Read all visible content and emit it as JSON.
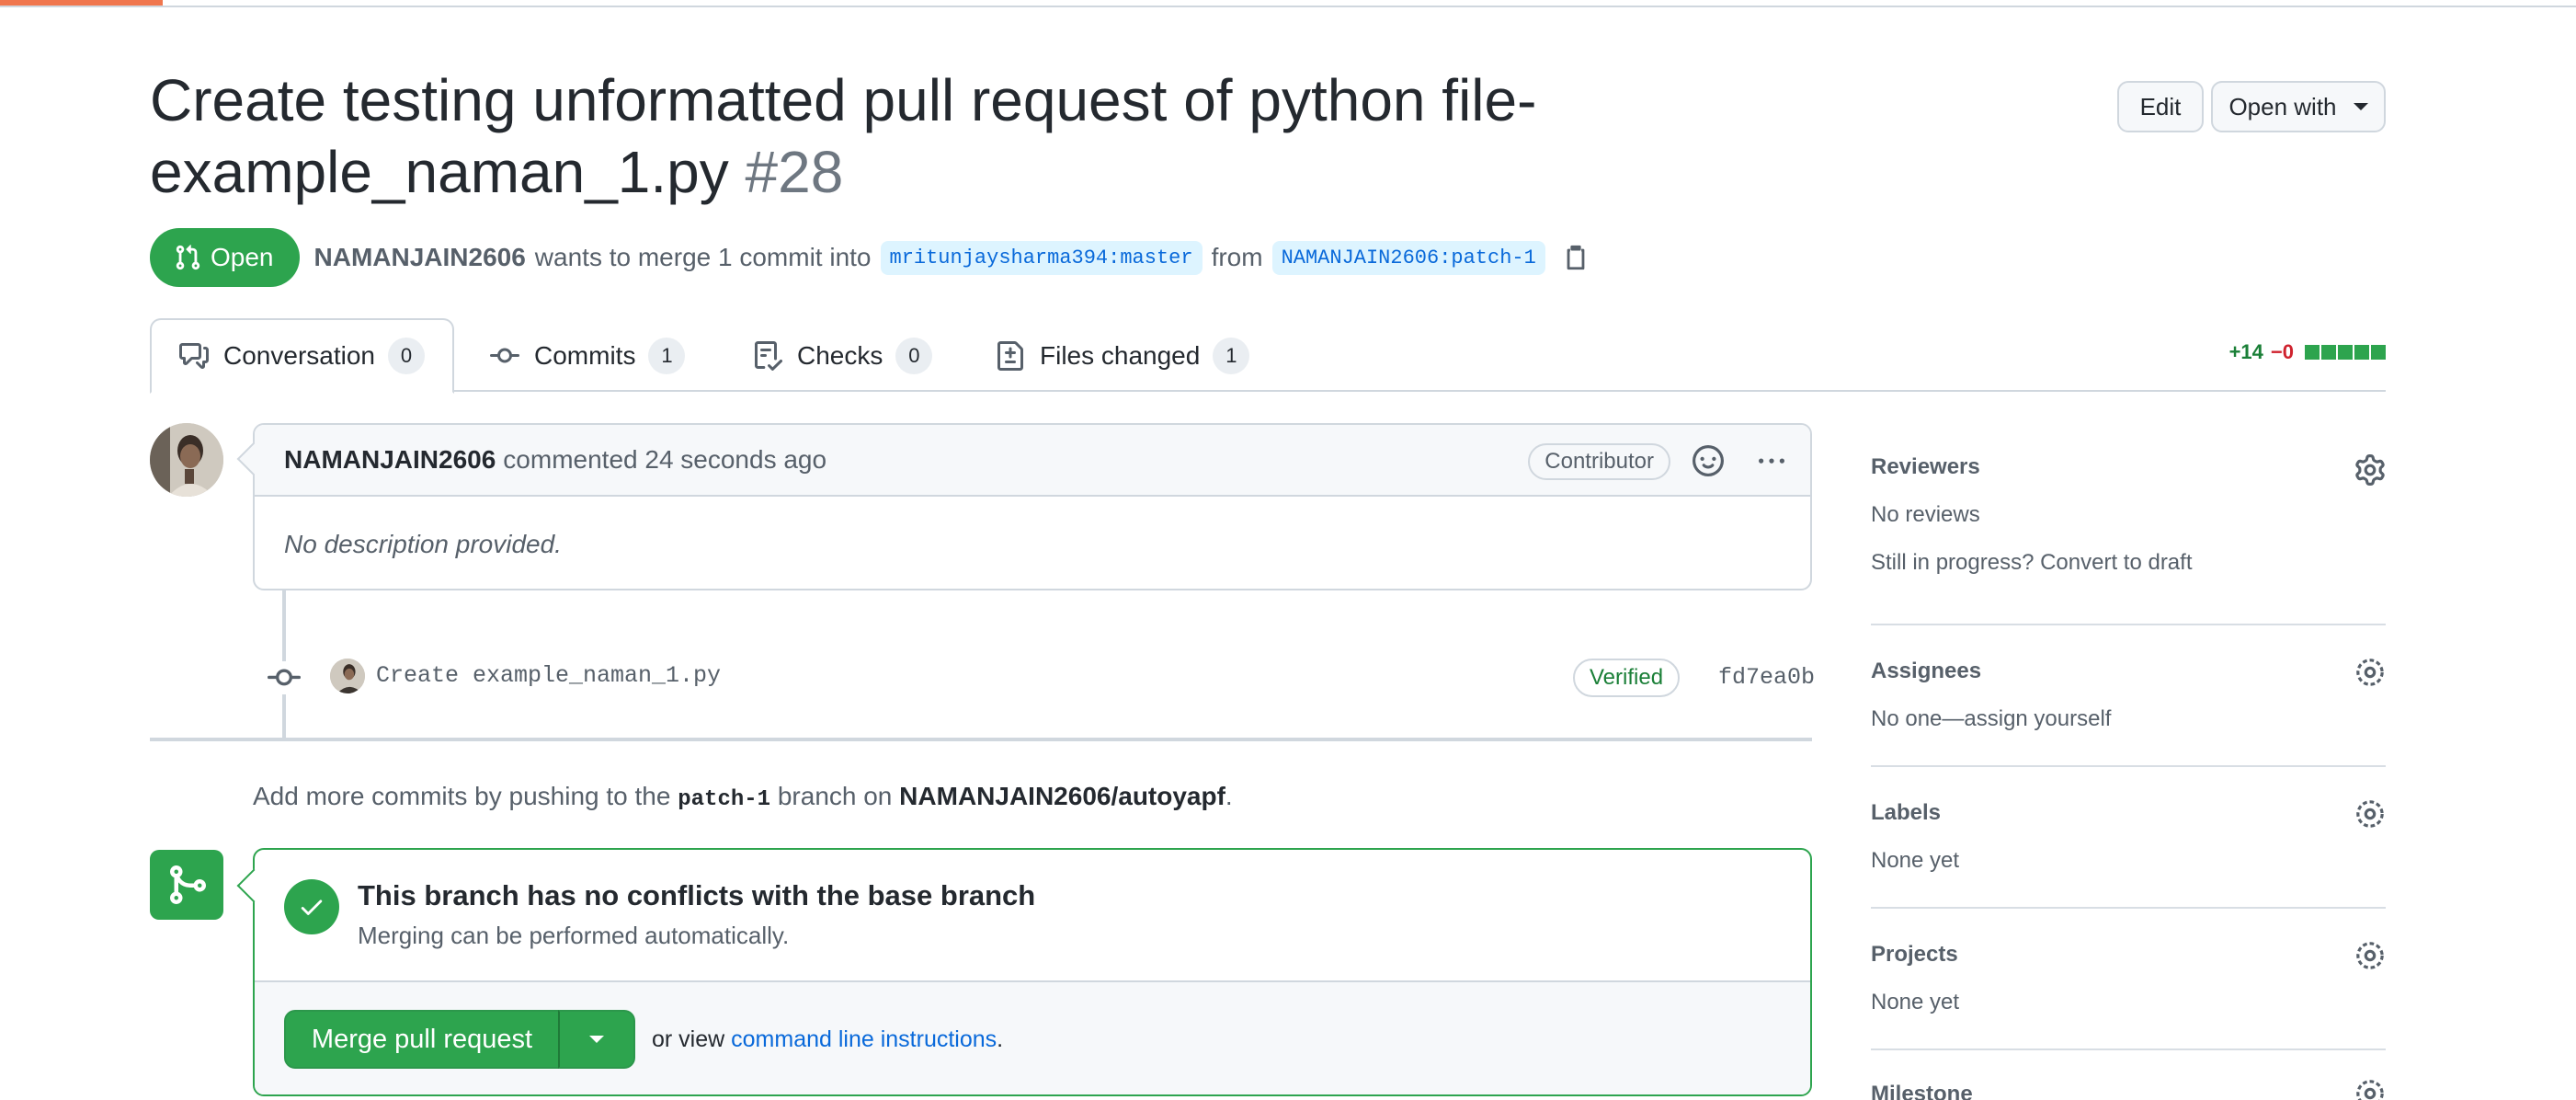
{
  "page_load_progress": 0.063,
  "header": {
    "title": "Create testing unformatted pull request of python file-example_naman_1.py",
    "number": "#28",
    "edit_label": "Edit",
    "open_with_label": "Open with"
  },
  "meta": {
    "state": "Open",
    "author": "NAMANJAIN2606",
    "merge_text": "wants to merge 1 commit into",
    "base_branch": "mritunjaysharma394:master",
    "from_text": "from",
    "head_branch": "NAMANJAIN2606:patch-1"
  },
  "tabs": [
    {
      "label": "Conversation",
      "count": "0"
    },
    {
      "label": "Commits",
      "count": "1"
    },
    {
      "label": "Checks",
      "count": "0"
    },
    {
      "label": "Files changed",
      "count": "1"
    }
  ],
  "diffstat": {
    "additions": "+14",
    "deletions": "−0"
  },
  "comment": {
    "author": "NAMANJAIN2606",
    "action": "commented 24 seconds ago",
    "badge": "Contributor",
    "body": "No description provided."
  },
  "commit": {
    "message": "Create example_naman_1.py",
    "verified": "Verified",
    "sha": "fd7ea0b"
  },
  "add_more": {
    "prefix": "Add more commits by pushing to the",
    "branch": "patch-1",
    "middle": "branch on",
    "repo": "NAMANJAIN2606/autoyapf",
    "suffix": "."
  },
  "mergebox": {
    "title": "This branch has no conflicts with the base branch",
    "subtitle": "Merging can be performed automatically.",
    "button": "Merge pull request",
    "or_view": "or view",
    "link": "command line instructions",
    "period": "."
  },
  "sidebar": {
    "reviewers": {
      "title": "Reviewers",
      "text": "No reviews",
      "draft": "Still in progress? Convert to draft"
    },
    "assignees": {
      "title": "Assignees",
      "text": "No one—assign yourself"
    },
    "labels": {
      "title": "Labels",
      "text": "None yet"
    },
    "projects": {
      "title": "Projects",
      "text": "None yet"
    },
    "milestone": {
      "title": "Milestone"
    }
  },
  "colors": {
    "accent_green": "#2da44e",
    "link_blue": "#0969da",
    "progress": "#f0764e"
  }
}
